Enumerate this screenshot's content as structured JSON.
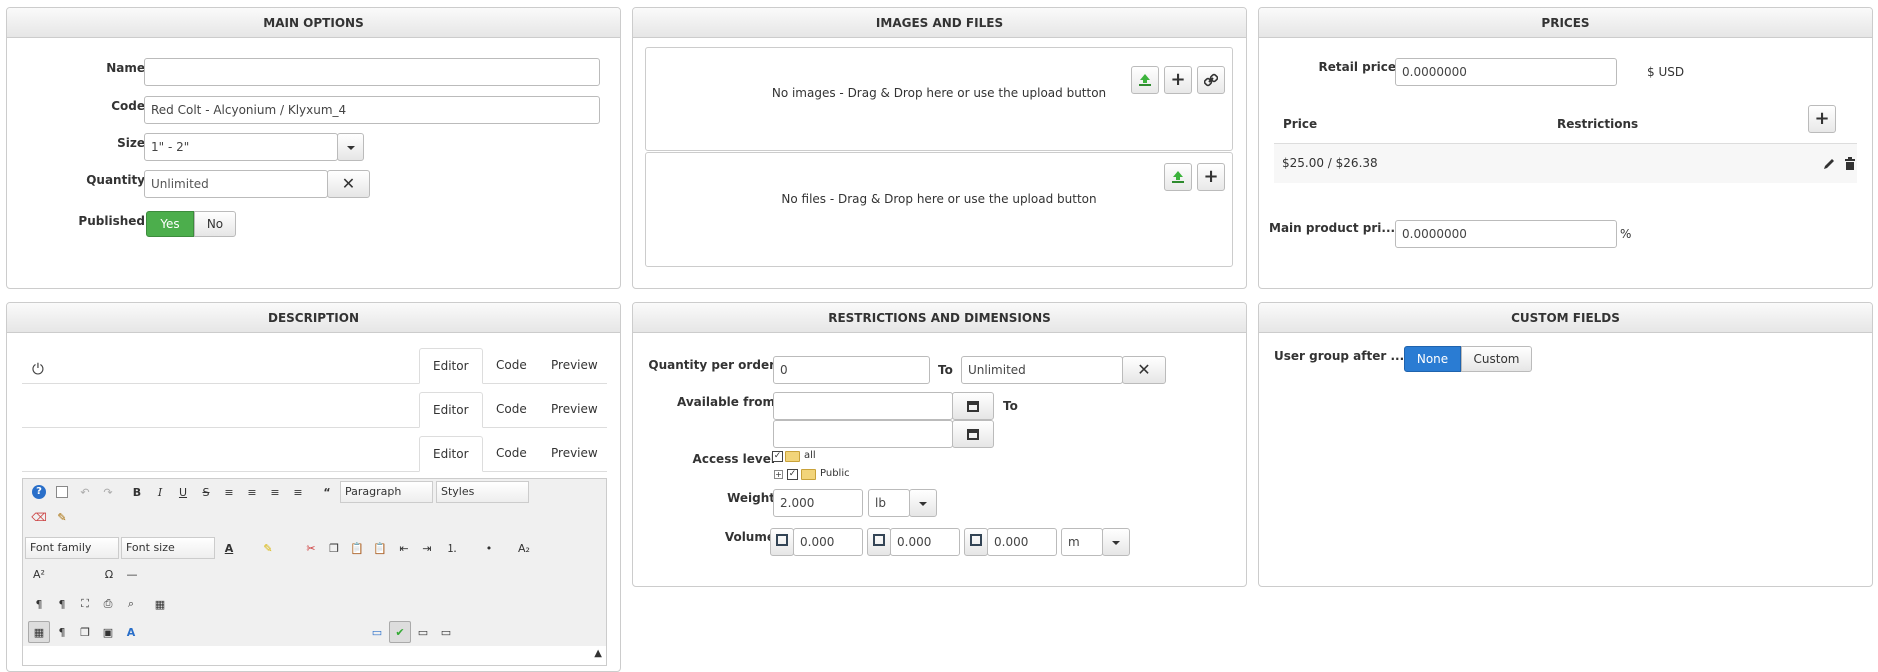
{
  "main_options": {
    "title": "MAIN OPTIONS",
    "name_label": "Name",
    "name_value": "",
    "code_label": "Code",
    "code_value": "Red Colt - Alcyonium / Klyxum_4",
    "size_label": "Size",
    "size_value": "1\" - 2\"",
    "quantity_label": "Quantity",
    "quantity_value": "Unlimited",
    "published_label": "Published",
    "published_yes": "Yes",
    "published_no": "No"
  },
  "images_files": {
    "title": "IMAGES AND FILES",
    "images_empty": "No images - Drag & Drop here or use the upload button",
    "files_empty": "No files - Drag & Drop here or use the upload button"
  },
  "prices": {
    "title": "PRICES",
    "retail_label": "Retail price",
    "retail_value": "0.0000000",
    "currency": "$ USD",
    "col_price": "Price",
    "col_restrictions": "Restrictions",
    "rows": [
      {
        "price": "$25.00 / $26.38",
        "restrictions": ""
      }
    ],
    "main_price_label": "Main product pri...",
    "main_price_value": "0.0000000",
    "main_price_unit": "%"
  },
  "description": {
    "title": "DESCRIPTION",
    "tabs": [
      "Editor",
      "Code",
      "Preview"
    ],
    "paragraph": "Paragraph",
    "styles": "Styles",
    "font_family": "Font family",
    "font_size": "Font size"
  },
  "restrictions": {
    "title": "RESTRICTIONS AND DIMENSIONS",
    "qty_label": "Quantity per order",
    "qty_from": "0",
    "to_label": "To",
    "qty_to": "Unlimited",
    "available_label": "Available from",
    "available_to": "To",
    "access_label": "Access level",
    "access_all": "all",
    "access_public": "Public",
    "weight_label": "Weight",
    "weight_value": "2.000",
    "weight_unit": "lb",
    "volume_label": "Volume",
    "vol_1": "0.000",
    "vol_2": "0.000",
    "vol_3": "0.000",
    "vol_unit": "m"
  },
  "custom_fields": {
    "title": "CUSTOM FIELDS",
    "user_group_label": "User group after ...",
    "opt_none": "None",
    "opt_custom": "Custom"
  },
  "colors": {
    "green": "#4cae4c",
    "blue": "#2a7cd3",
    "border": "#cccccc"
  }
}
